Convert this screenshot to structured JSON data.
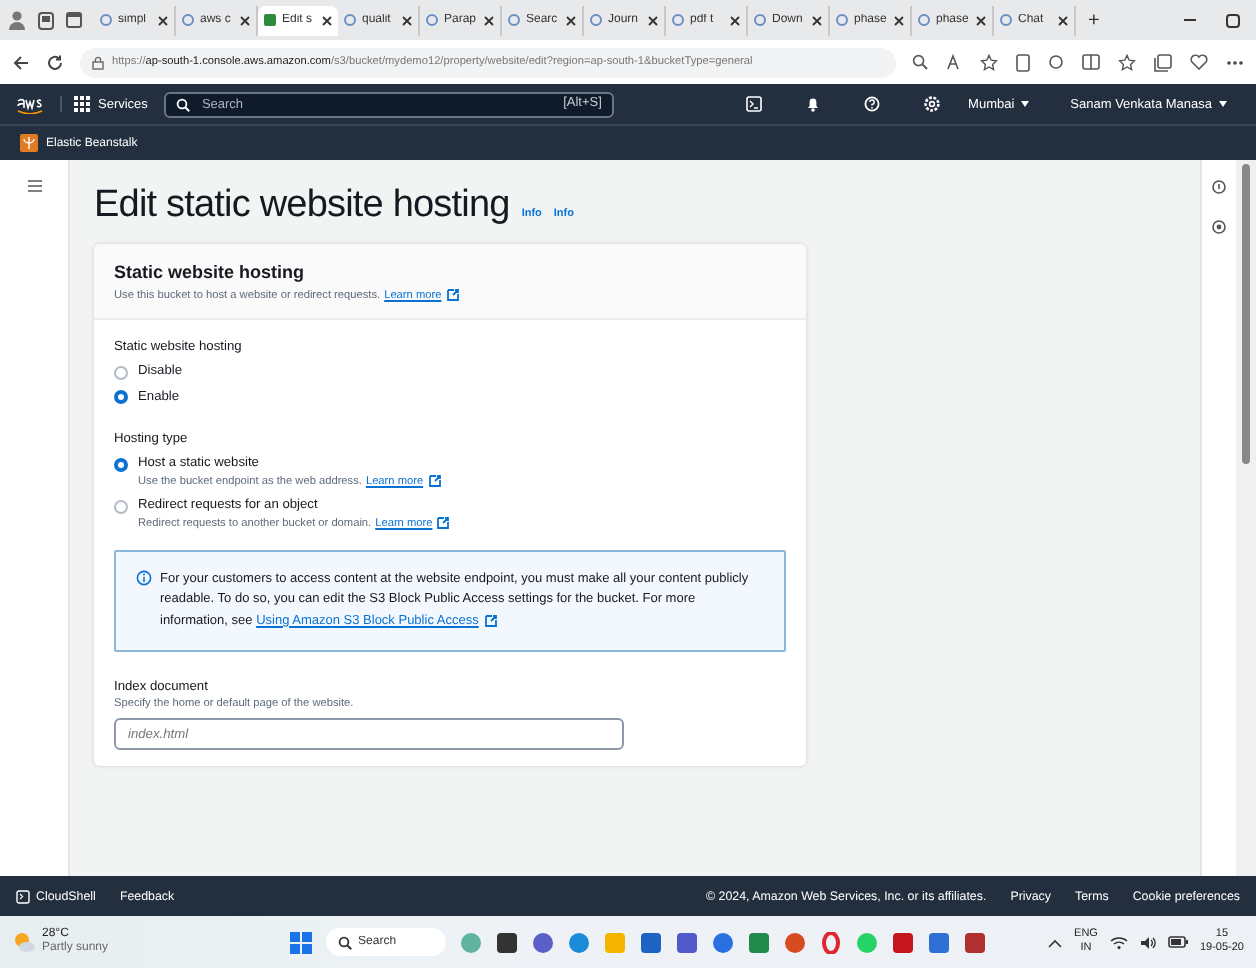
{
  "browser": {
    "tabs": [
      {
        "label": "simpl",
        "selected": false
      },
      {
        "label": "aws c",
        "selected": false
      },
      {
        "label": "Edit s",
        "selected": true
      },
      {
        "label": "qualit",
        "selected": false
      },
      {
        "label": "Parap",
        "selected": false
      },
      {
        "label": "Searc",
        "selected": false
      },
      {
        "label": "Journ",
        "selected": false
      },
      {
        "label": "pdf t",
        "selected": false
      },
      {
        "label": "Down",
        "selected": false
      },
      {
        "label": "phase",
        "selected": false
      },
      {
        "label": "phase",
        "selected": false
      },
      {
        "label": "Chat",
        "selected": false
      }
    ],
    "new_tab": "+",
    "url": "https://**ap-south-1.console.aws.amazon.com**/s3/bucket/mydemo12/property/website/edit?region=ap-south-1&bucketType=general"
  },
  "nav": {
    "services": "Services",
    "search": {
      "placeholder": "Search"
    },
    "shortcut": "[Alt+S]",
    "region": "Mumbai",
    "user": "Sanam Venkata Manasa",
    "service_bar": "Elastic Beanstalk"
  },
  "page": {
    "title": "Edit static website hosting",
    "info_links": [
      "Info",
      "Info"
    ]
  },
  "card": {
    "title": "Static website hosting",
    "description": "Use this bucket to host a website or redirect requests.",
    "learn_more": "Learn more",
    "hosting_toggle": {
      "label": "Static website hosting",
      "options": [
        {
          "label": "Disable",
          "selected": false
        },
        {
          "label": "Enable",
          "selected": true
        }
      ]
    },
    "hosting_type": {
      "label": "Hosting type",
      "options": [
        {
          "label": "Host a static website",
          "description": "Use the bucket endpoint as the web address.",
          "link": "Learn more",
          "selected": true
        },
        {
          "label": "Redirect requests for an object",
          "description": "Redirect requests to another bucket or domain.",
          "link": "Learn more",
          "selected": false
        }
      ]
    },
    "alert": {
      "text": "For your customers to access content at the website endpoint, you must make all your content publicly readable. To do so, you can edit the S3 Block Public Access settings for the bucket. For more information, see",
      "link": "Using Amazon S3 Block Public Access"
    },
    "index_document": {
      "label": "Index document",
      "hint": "Specify the home or default page of the website.",
      "placeholder": "index.html"
    }
  },
  "footer": {
    "left": [
      "CloudShell",
      "Feedback"
    ],
    "copyright": "© 2024, Amazon Web Services, Inc. or its affiliates.",
    "links": [
      "Privacy",
      "Terms",
      "Cookie preferences"
    ]
  },
  "taskbar": {
    "temperature": "28°C",
    "weather": "Partly sunny",
    "search": {
      "placeholder": "Search"
    },
    "language": "ENG",
    "region": "IN",
    "time": "15",
    "date": "19-05-20"
  }
}
